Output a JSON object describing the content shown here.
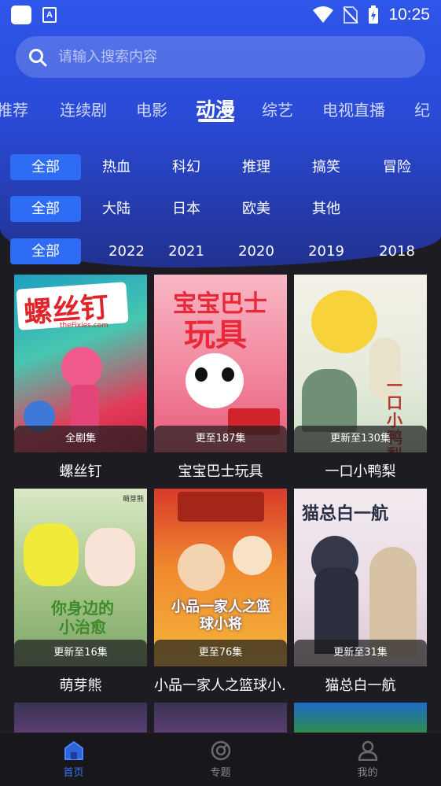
{
  "status_bar": {
    "time": "10:25",
    "notification_badge": "A"
  },
  "search": {
    "placeholder": "请输入搜索内容"
  },
  "category_tabs": [
    "推荐",
    "连续剧",
    "电影",
    "动漫",
    "综艺",
    "电视直播",
    "纪"
  ],
  "active_tab": "动漫",
  "filters": {
    "genre": [
      "全部",
      "热血",
      "科幻",
      "推理",
      "搞笑",
      "冒险"
    ],
    "region": [
      "全部",
      "大陆",
      "日本",
      "欧美",
      "其他"
    ],
    "year": [
      "全部",
      "2022",
      "2021",
      "2020",
      "2019",
      "2018"
    ]
  },
  "cards": [
    {
      "title": "螺丝钉",
      "badge": "全剧集",
      "poster_text": "螺丝钉",
      "poster_subtext": "theFixies.com"
    },
    {
      "title": "宝宝巴士玩具",
      "badge": "更至187集",
      "poster_text": "宝宝巴士",
      "poster_subtext": "玩具"
    },
    {
      "title": "一口小鸭梨",
      "badge": "更新至130集",
      "poster_text": "一口小鸭梨"
    },
    {
      "title": "萌芽熊",
      "badge": "更新至16集",
      "poster_text": "你身边的小治愈",
      "poster_subtext": "萌芽熊"
    },
    {
      "title": "小品一家人之篮球小...",
      "badge": "更至76集",
      "poster_text": "小品一家人之篮球小将"
    },
    {
      "title": "猫总白一航",
      "badge": "更新至31集",
      "poster_text": "猫总白一航"
    }
  ],
  "bottom_nav": [
    {
      "label": "首页",
      "icon": "home-icon",
      "active": true
    },
    {
      "label": "专题",
      "icon": "topic-icon",
      "active": false
    },
    {
      "label": "我的",
      "icon": "profile-icon",
      "active": false
    }
  ],
  "colors": {
    "accent": "#2e6cf6",
    "header": "#2a4ad6",
    "background": "#1c1c22",
    "nav_active": "#3a76f5"
  }
}
